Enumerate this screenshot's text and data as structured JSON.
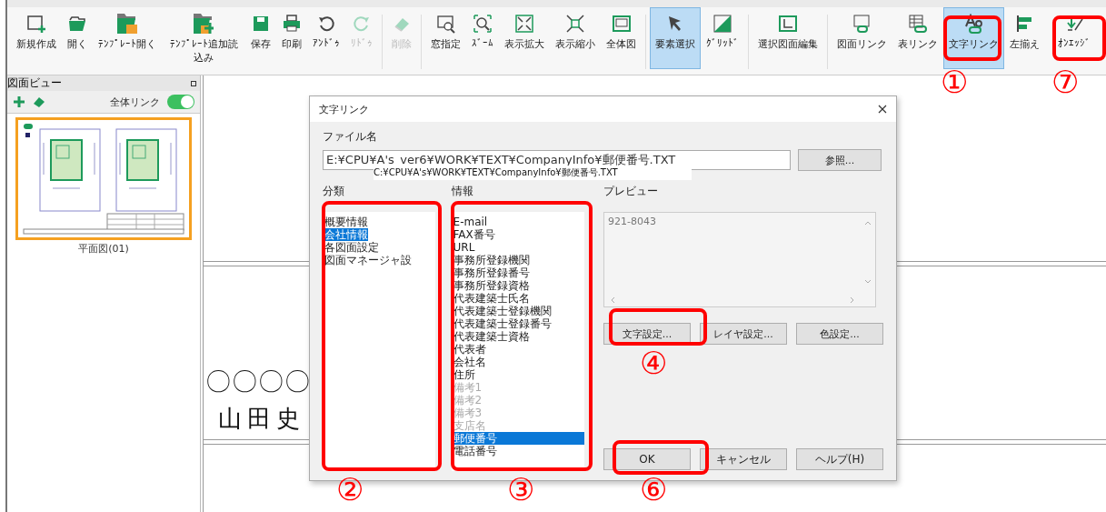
{
  "toolbar": [
    {
      "label": "新規作成",
      "disabled": false,
      "selected": false
    },
    {
      "label": "開く",
      "disabled": false,
      "selected": false
    },
    {
      "label": "ﾃﾝﾌﾟﾚｰﾄ開く",
      "disabled": false,
      "selected": false
    },
    {
      "label": "ﾃﾝﾌﾟﾚｰﾄ追加読込み",
      "disabled": false,
      "selected": false
    },
    {
      "label": "保存",
      "disabled": false,
      "selected": false
    },
    {
      "label": "印刷",
      "disabled": false,
      "selected": false
    },
    {
      "label": "ｱﾝﾄﾞｩ",
      "disabled": false,
      "selected": false
    },
    {
      "label": "ﾘﾄﾞｩ",
      "disabled": true,
      "selected": false
    },
    {
      "label": "削除",
      "disabled": true,
      "selected": false
    },
    {
      "label": "窓指定",
      "disabled": false,
      "selected": false
    },
    {
      "label": "ｽﾞｰﾑ",
      "disabled": false,
      "selected": false
    },
    {
      "label": "表示拡大",
      "disabled": false,
      "selected": false
    },
    {
      "label": "表示縮小",
      "disabled": false,
      "selected": false
    },
    {
      "label": "全体図",
      "disabled": false,
      "selected": false
    },
    {
      "label": "要素選択",
      "disabled": false,
      "selected": true
    },
    {
      "label": "ｸﾞﾘｯﾄﾞ",
      "disabled": false,
      "selected": false
    },
    {
      "label": "選択図面編集",
      "disabled": false,
      "selected": false
    },
    {
      "label": "図面リンク",
      "disabled": false,
      "selected": false
    },
    {
      "label": "表リンク",
      "disabled": false,
      "selected": false
    },
    {
      "label": "文字リンク",
      "disabled": false,
      "selected": true
    },
    {
      "label": "左揃え",
      "disabled": false,
      "selected": false
    },
    {
      "label": "ｵﾝｴｯｼﾞ",
      "disabled": false,
      "selected": false
    }
  ],
  "sidebar": {
    "title": "図面ビュー",
    "link_all": {
      "label": "全体リンク",
      "on": true
    },
    "thumbnails": [
      {
        "label": "平面図(01)",
        "selected": true
      }
    ]
  },
  "canvas": {
    "texts": [
      "〇〇〇〇",
      "山田史"
    ]
  },
  "dialog": {
    "title": "文字リンク",
    "file_label": "ファイル名",
    "file_value": "E:¥CPU¥A's_ver6¥WORK¥TEXT¥CompanyInfo¥郵便番号.TXT",
    "browse_button": "参照...",
    "path_overlay": "C:¥CPU¥A's¥WORK¥TEXT¥CompanyInfo¥郵便番号.TXT",
    "category": {
      "label": "分類",
      "items": [
        {
          "label": "概要情報",
          "selected": false
        },
        {
          "label": "会社情報",
          "selected": true
        },
        {
          "label": "各図面設定",
          "selected": false
        },
        {
          "label": "図面マネージャ設",
          "selected": false
        }
      ]
    },
    "info": {
      "label": "情報",
      "items": [
        {
          "label": "E-mail",
          "disabled": false,
          "selected": false
        },
        {
          "label": "FAX番号",
          "disabled": false,
          "selected": false
        },
        {
          "label": "URL",
          "disabled": false,
          "selected": false
        },
        {
          "label": "事務所登録機関",
          "disabled": false,
          "selected": false
        },
        {
          "label": "事務所登録番号",
          "disabled": false,
          "selected": false
        },
        {
          "label": "事務所登録資格",
          "disabled": false,
          "selected": false
        },
        {
          "label": "代表建築士氏名",
          "disabled": false,
          "selected": false
        },
        {
          "label": "代表建築士登録機関",
          "disabled": false,
          "selected": false
        },
        {
          "label": "代表建築士登録番号",
          "disabled": false,
          "selected": false
        },
        {
          "label": "代表建築士資格",
          "disabled": false,
          "selected": false
        },
        {
          "label": "代表者",
          "disabled": false,
          "selected": false
        },
        {
          "label": "会社名",
          "disabled": false,
          "selected": false
        },
        {
          "label": "住所",
          "disabled": false,
          "selected": false
        },
        {
          "label": "備考1",
          "disabled": true,
          "selected": false
        },
        {
          "label": "備考2",
          "disabled": true,
          "selected": false
        },
        {
          "label": "備考3",
          "disabled": true,
          "selected": false
        },
        {
          "label": "支店名",
          "disabled": true,
          "selected": false
        },
        {
          "label": "郵便番号",
          "disabled": false,
          "selected": true
        },
        {
          "label": "電話番号",
          "disabled": false,
          "selected": false
        }
      ]
    },
    "preview": {
      "label": "プレビュー",
      "text": "921-8043"
    },
    "setting_buttons": [
      "文字設定...",
      "レイヤ設定...",
      "色設定..."
    ],
    "footer_buttons": [
      "OK",
      "キャンセル",
      "ヘルプ(H)"
    ]
  },
  "annotations": [
    {
      "label": "①"
    },
    {
      "label": "⑦"
    },
    {
      "label": "②"
    },
    {
      "label": "③"
    },
    {
      "label": "④"
    },
    {
      "label": "⑥"
    }
  ]
}
